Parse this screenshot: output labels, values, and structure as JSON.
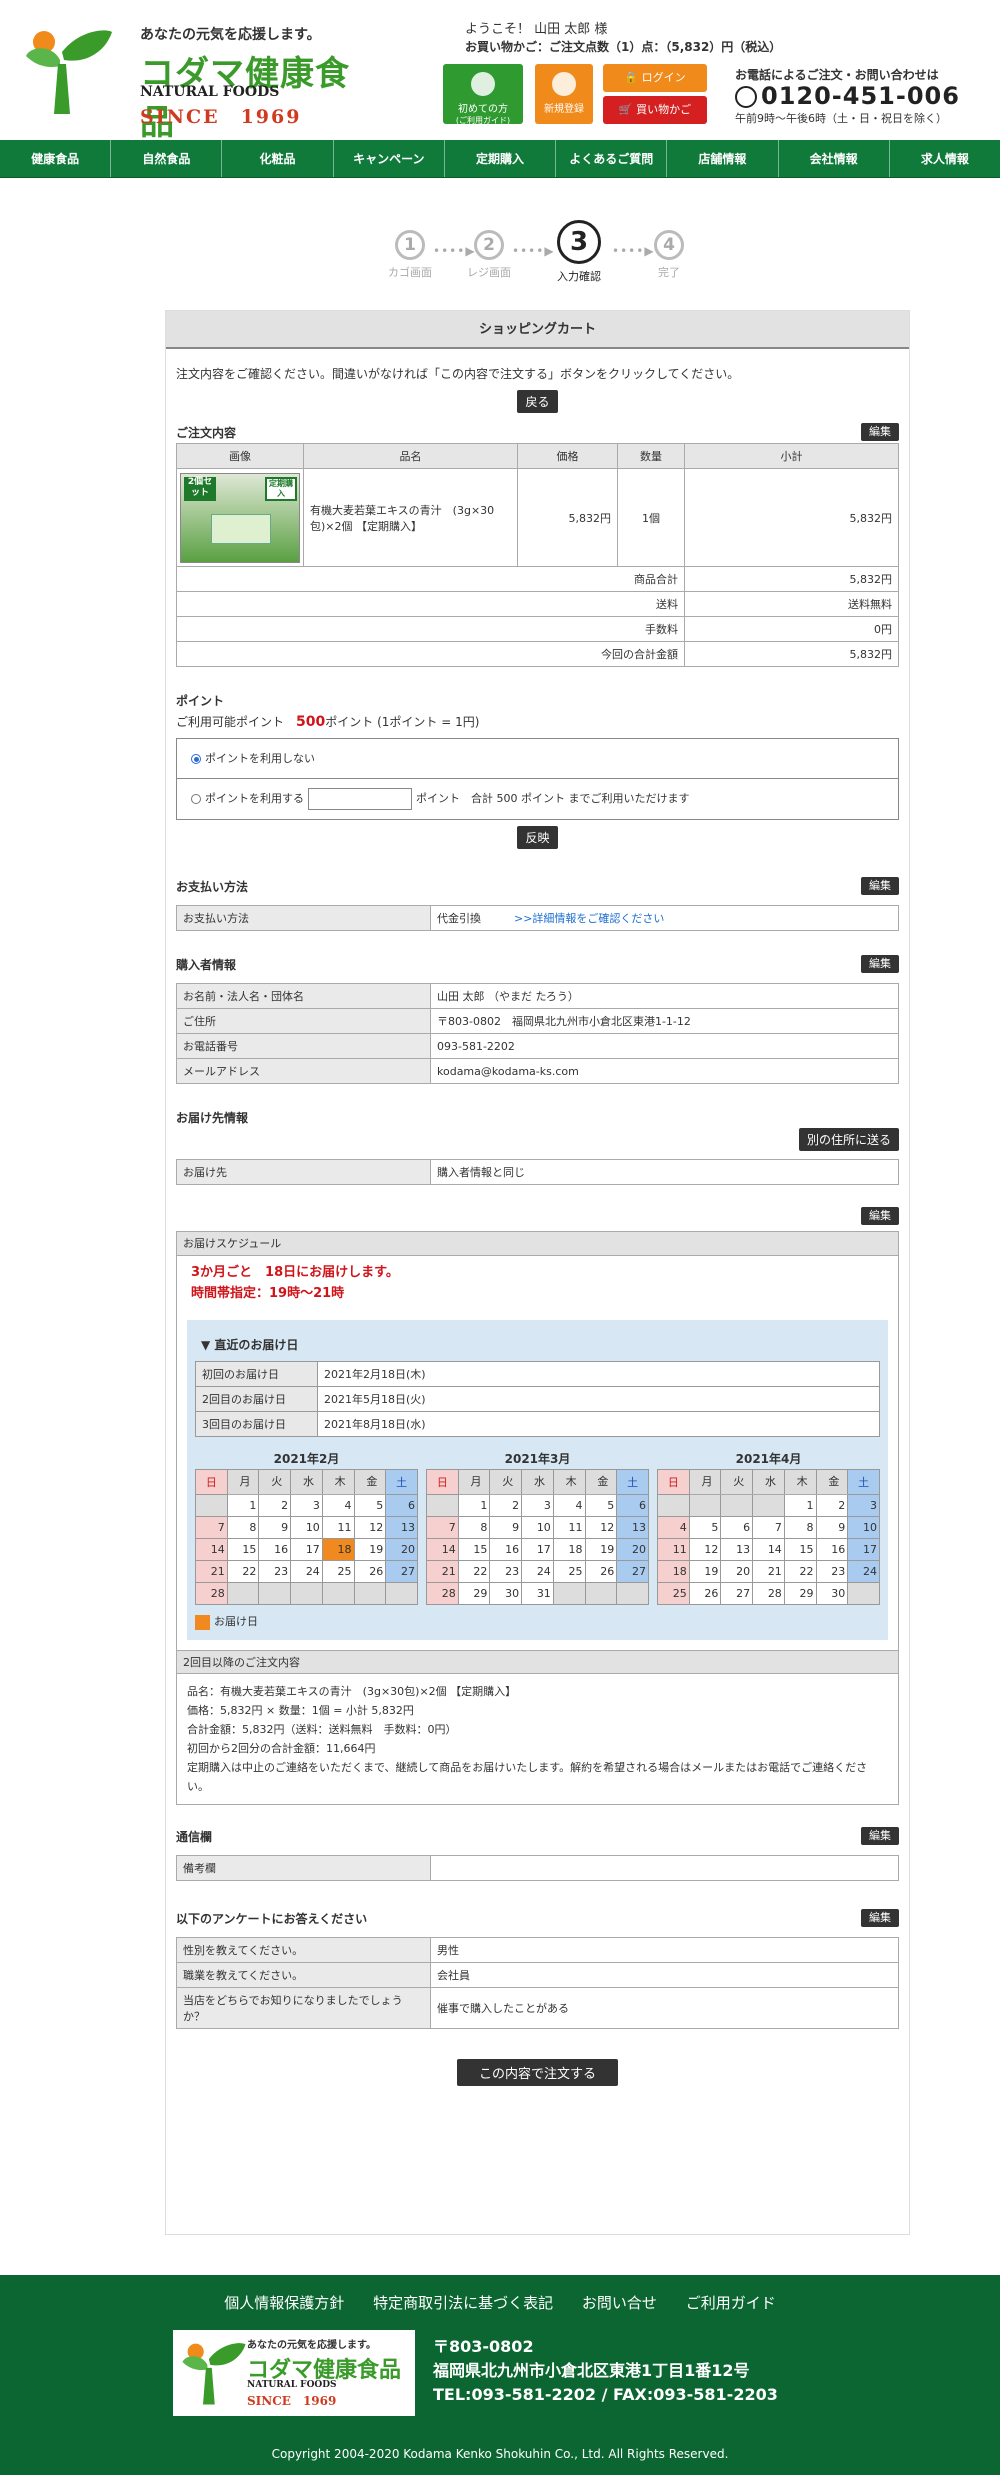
{
  "header": {
    "tagline": "あなたの元気を応援します。",
    "brand": "コダマ健康食品",
    "natural_foods": "NATURAL FOODS",
    "since": "SINCE　1969",
    "welcome": "ようこそ！ 山田 太郎 様",
    "cart_info": "お買い物かご：ご注文点数（1）点：（5,832）円（税込）",
    "first_time": "初めての方",
    "first_time_sub": "(ご利用ガイド)",
    "register": "新規登録",
    "login": "ログイン",
    "cart": "買い物かご",
    "phone_label": "お電話によるご注文・お問い合わせは",
    "phone": "0120-451-006",
    "hours": "午前9時〜午後6時（土・日・祝日を除く）"
  },
  "nav": [
    "健康食品",
    "自然食品",
    "化粧品",
    "キャンペーン",
    "定期購入",
    "よくあるご質問",
    "店舗情報",
    "会社情報",
    "求人情報"
  ],
  "steps": [
    {
      "num": "1",
      "label": "カゴ画面"
    },
    {
      "num": "2",
      "label": "レジ画面"
    },
    {
      "num": "3",
      "label": "入力確認"
    },
    {
      "num": "4",
      "label": "完了"
    }
  ],
  "cart": {
    "title": "ショッピングカート",
    "note": "注文内容をご確認ください。間違いがなければ「この内容で注文する」ボタンをクリックしてください。",
    "back": "戻る",
    "order_heading": "ご注文内容",
    "edit": "編集",
    "cols": [
      "画像",
      "品名",
      "価格",
      "数量",
      "小計"
    ],
    "item": {
      "badge1": "2個セット",
      "badge2": "定期購入",
      "name": "有機大麦若葉エキスの青汁　(3g×30包)×2個 【定期購入】",
      "price": "5,832円",
      "qty": "1個",
      "subtotal": "5,832円"
    },
    "totals": [
      {
        "label": "商品合計",
        "value": "5,832円"
      },
      {
        "label": "送料",
        "value": "送料無料"
      },
      {
        "label": "手数料",
        "value": "0円"
      },
      {
        "label": "今回の合計金額",
        "value": "5,832円"
      }
    ]
  },
  "points": {
    "heading": "ポイント",
    "available_pre": "ご利用可能ポイント",
    "available_num": "500",
    "available_post": "ポイント (1ポイント = 1円)",
    "no_use": "ポイントを利用しない",
    "use": "ポイントを利用する",
    "use_suffix": "ポイント　合計 500 ポイント までご利用いただけます",
    "apply": "反映"
  },
  "payment": {
    "heading": "お支払い方法",
    "label": "お支払い方法",
    "value": "代金引換",
    "link": ">>詳細情報をご確認ください"
  },
  "buyer": {
    "heading": "購入者情報",
    "rows": [
      {
        "label": "お名前・法人名・団体名",
        "value": "山田 太郎 （やまだ たろう）"
      },
      {
        "label": "ご住所",
        "value": "〒803-0802　福岡県北九州市小倉北区東港1-1-12"
      },
      {
        "label": "お電話番号",
        "value": "093-581-2202"
      },
      {
        "label": "メールアドレス",
        "value": "kodama@kodama-ks.com"
      }
    ]
  },
  "delivery": {
    "heading": "お届け先情報",
    "other": "別の住所に送る",
    "label": "お届け先",
    "value": "購入者情報と同じ"
  },
  "schedule": {
    "heading": "お届けスケジュール",
    "line1": "3か月ごと　18日にお届けします。",
    "line2": "時間帯指定：19時〜21時",
    "recent": "▼ 直近のお届け日",
    "dates": [
      {
        "label": "初回のお届け日",
        "value": "2021年2月18日(木)"
      },
      {
        "label": "2回目のお届け日",
        "value": "2021年5月18日(火)"
      },
      {
        "label": "3回目のお届け日",
        "value": "2021年8月18日(水)"
      }
    ],
    "weekdays": [
      "日",
      "月",
      "火",
      "水",
      "木",
      "金",
      "土"
    ],
    "months": [
      {
        "title": "2021年2月",
        "start": 1,
        "days": 28,
        "deliver": 18
      },
      {
        "title": "2021年3月",
        "start": 1,
        "days": 31,
        "deliver": 0
      },
      {
        "title": "2021年4月",
        "start": 4,
        "days": 30,
        "deliver": 0
      }
    ],
    "legend": "お届け日"
  },
  "order2": {
    "heading": "2回目以降のご注文内容",
    "lines": [
      "品名：有機大麦若葉エキスの青汁　(3g×30包)×2個 【定期購入】",
      "価格：5,832円 × 数量：1個 = 小計 5,832円",
      "合計金額：5,832円（送料：送料無料　手数料：0円）",
      "初回から2回分の合計金額：11,664円",
      "定期購入は中止のご連絡をいただくまで、継続して商品をお届けいたします。解約を希望される場合はメールまたはお電話でご連絡ください。"
    ]
  },
  "comm": {
    "heading": "通信欄",
    "label": "備考欄",
    "value": ""
  },
  "survey": {
    "heading": "以下のアンケートにお答えください",
    "rows": [
      {
        "label": "性別を教えてください。",
        "value": "男性"
      },
      {
        "label": "職業を教えてください。",
        "value": "会社員"
      },
      {
        "label": "当店をどちらでお知りになりましたでしょうか？",
        "value": "催事で購入したことがある"
      }
    ]
  },
  "submit": "この内容で注文する",
  "footer": {
    "links": [
      "個人情報保護方針",
      "特定商取引法に基づく表記",
      "お問い合せ",
      "ご利用ガイド"
    ],
    "zip": "〒803-0802",
    "address": "福岡県北九州市小倉北区東港1丁目1番12号",
    "tel": "TEL:093-581-2202 / FAX:093-581-2203",
    "copyright": "Copyright 2004-2020 Kodama Kenko Shokuhin Co., Ltd. All Rights Reserved."
  },
  "colors": {
    "nav_green": "#0f7a3a",
    "brand_green": "#3a9a2a",
    "red": "#d0141a",
    "orange": "#f08a1a",
    "delivery_orange": "#f08a20"
  }
}
